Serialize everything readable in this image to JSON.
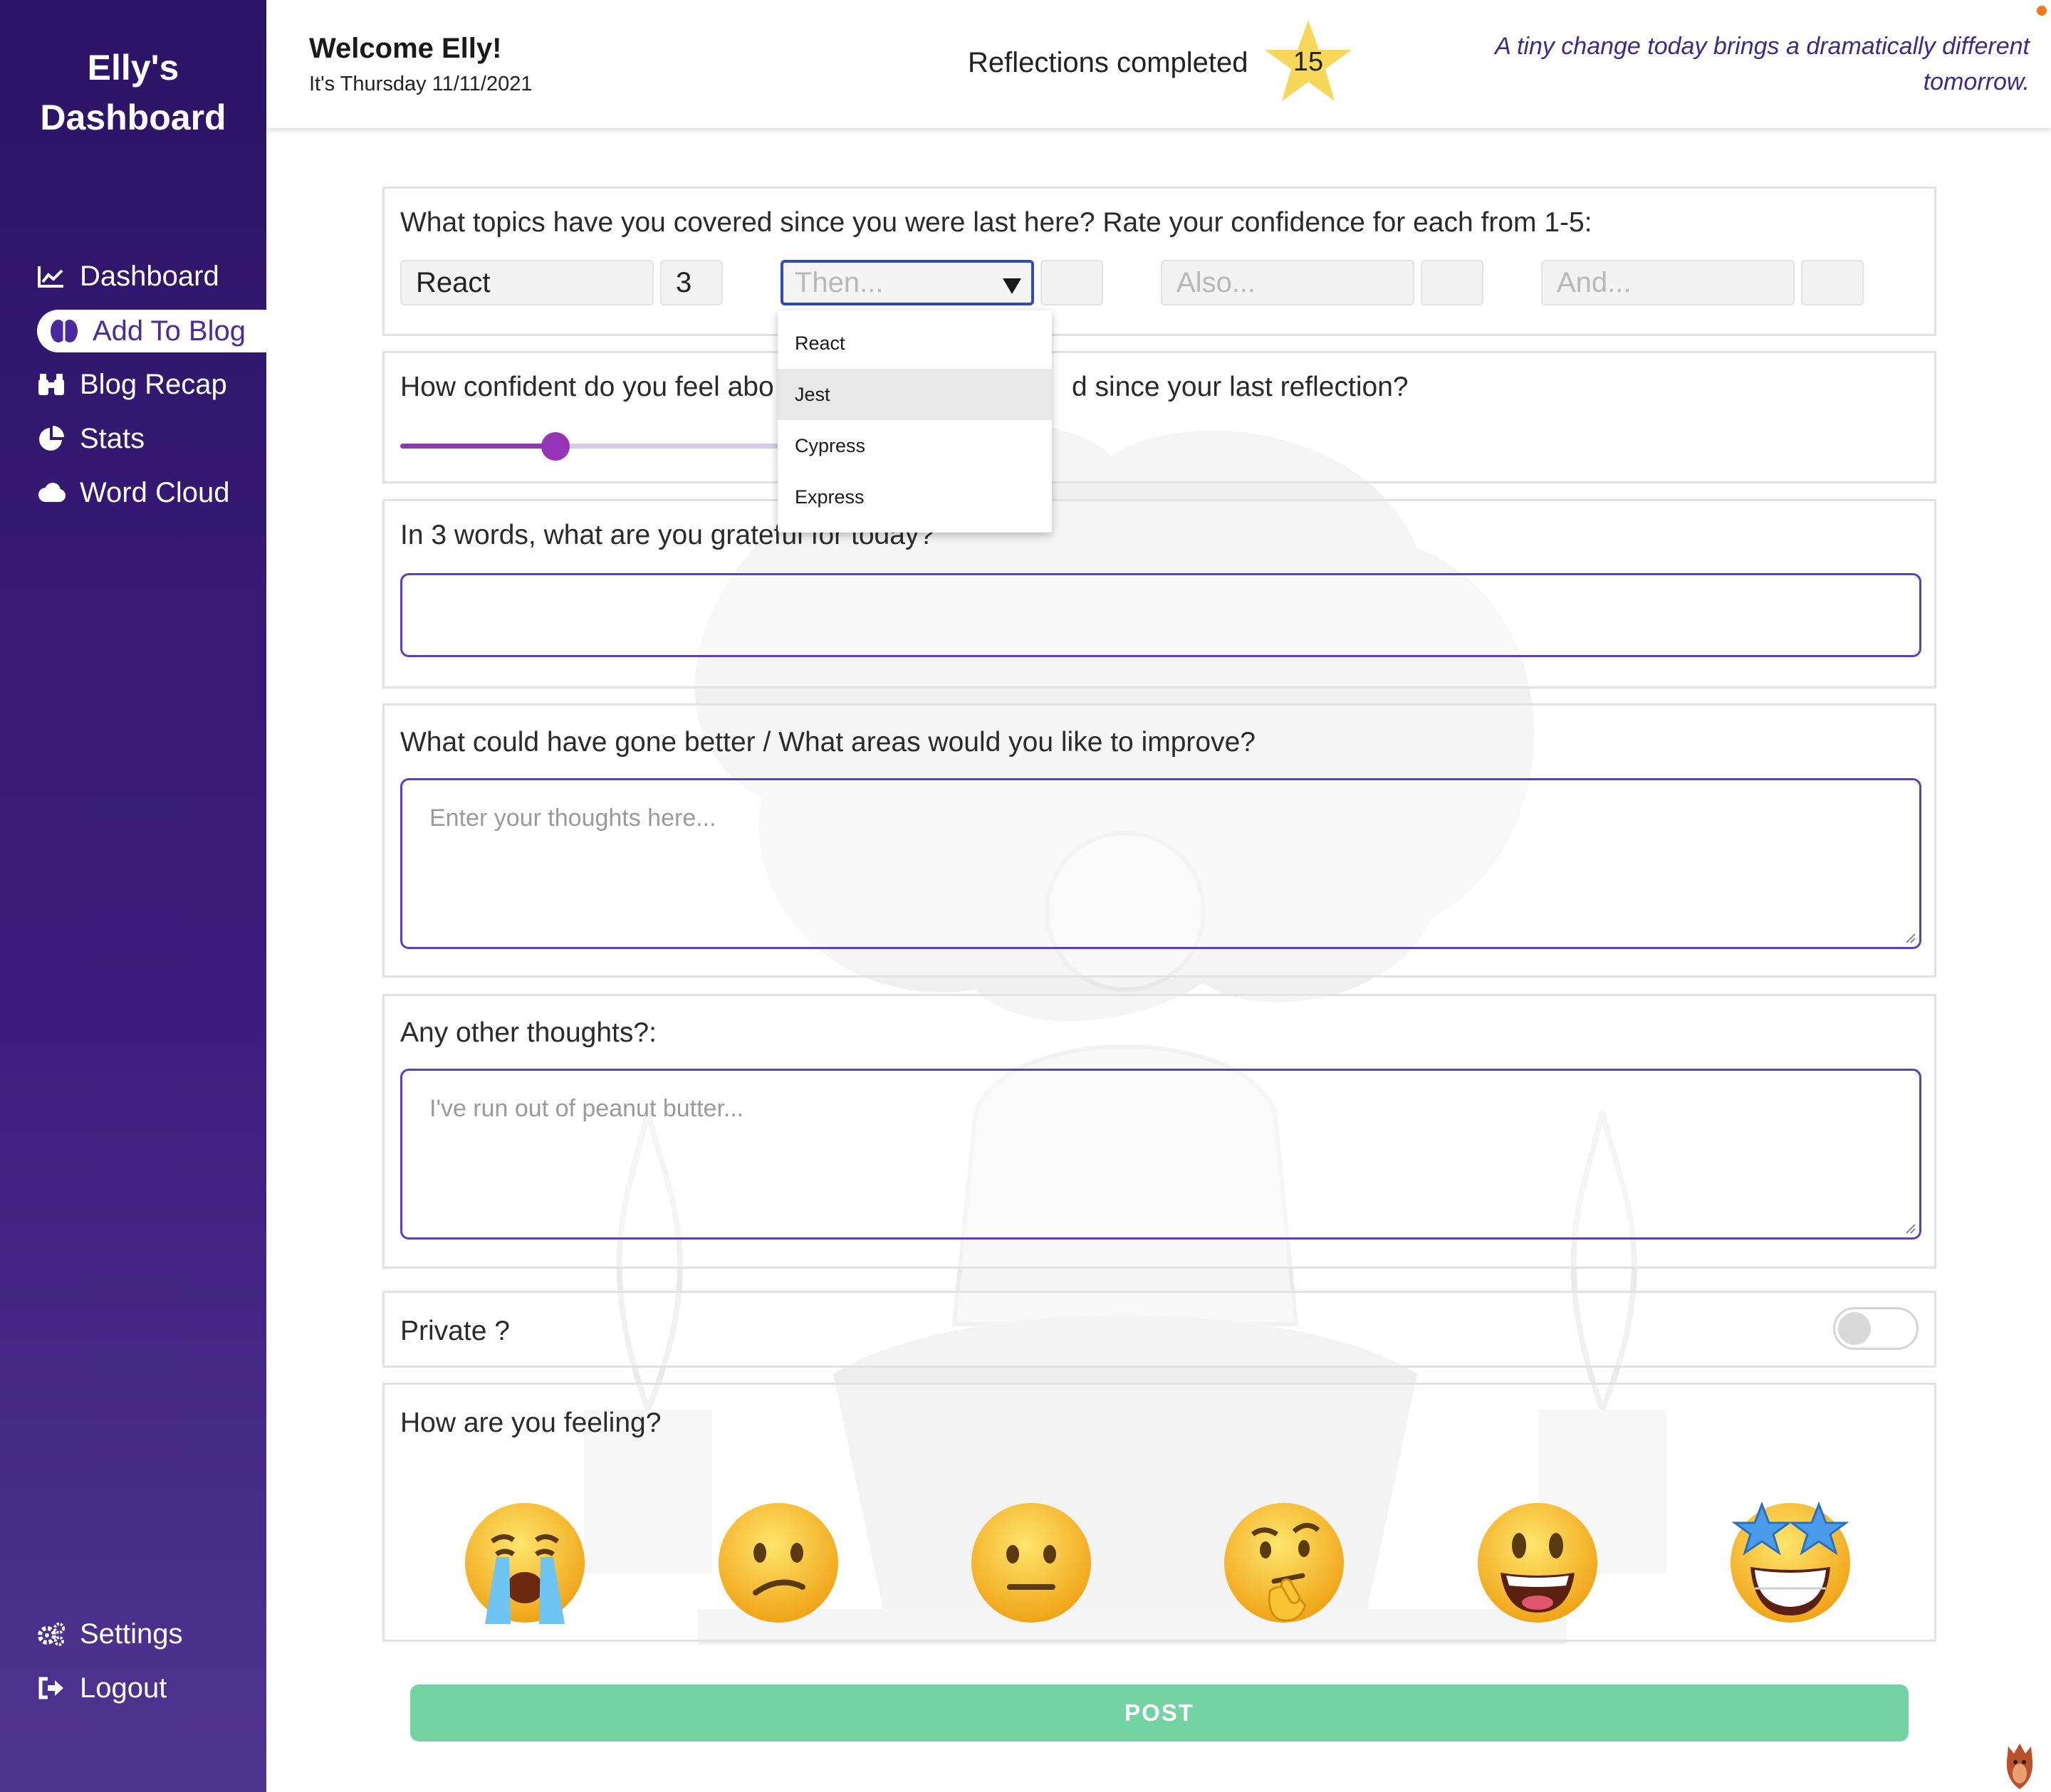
{
  "sidebar": {
    "brand_line1": "Elly's",
    "brand_line2": "Dashboard",
    "items": [
      {
        "label": "Dashboard",
        "icon": "line-chart-icon"
      },
      {
        "label": "Add To Blog",
        "icon": "brain-icon",
        "active": true
      },
      {
        "label": "Blog Recap",
        "icon": "binoculars-icon"
      },
      {
        "label": "Stats",
        "icon": "pie-chart-icon"
      },
      {
        "label": "Word Cloud",
        "icon": "cloud-icon"
      }
    ],
    "bottom_items": [
      {
        "label": "Settings",
        "icon": "gears-icon"
      },
      {
        "label": "Logout",
        "icon": "logout-icon"
      }
    ]
  },
  "header": {
    "welcome": "Welcome Elly!",
    "date": "It's Thursday 11/11/2021",
    "reflections_label": "Reflections completed",
    "reflections_count": "15",
    "quote": "A tiny change today brings a dramatically different tomorrow."
  },
  "form": {
    "topics": {
      "question": "What topics have you covered since you were last here? Rate your confidence for each from 1-5:",
      "topic1_value": "React",
      "rating1_value": "3",
      "topic2_placeholder": "Then...",
      "topic3_placeholder": "Also...",
      "topic4_placeholder": "And...",
      "dropdown_options": [
        "React",
        "Jest",
        "Cypress",
        "Express"
      ],
      "dropdown_highlighted": "Jest"
    },
    "confidence": {
      "question": "How confident do you feel abo",
      "question_tail": "d since your last reflection?",
      "slider_value_fraction": 0.39
    },
    "grateful": {
      "question": "In 3 words, what are you grateful for today?",
      "value": ""
    },
    "improve": {
      "question": "What could have gone better / What areas would you like to improve?",
      "placeholder": "Enter your thoughts here..."
    },
    "other": {
      "question": "Any other thoughts?:",
      "placeholder": "I've run out of peanut butter..."
    },
    "private": {
      "label": "Private ?",
      "enabled": false
    },
    "feeling": {
      "question": "How are you feeling?",
      "options": [
        "crying-face",
        "confused-face",
        "neutral-face",
        "thinking-face",
        "grinning-face",
        "star-struck-face"
      ]
    },
    "post_label": "POST"
  },
  "colors": {
    "sidebar_top": "#2d1466",
    "accent_purple": "#9634b8",
    "border_purple": "#5a3fc0",
    "post_green": "#74d3a3",
    "star_yellow": "#f7d85a"
  }
}
